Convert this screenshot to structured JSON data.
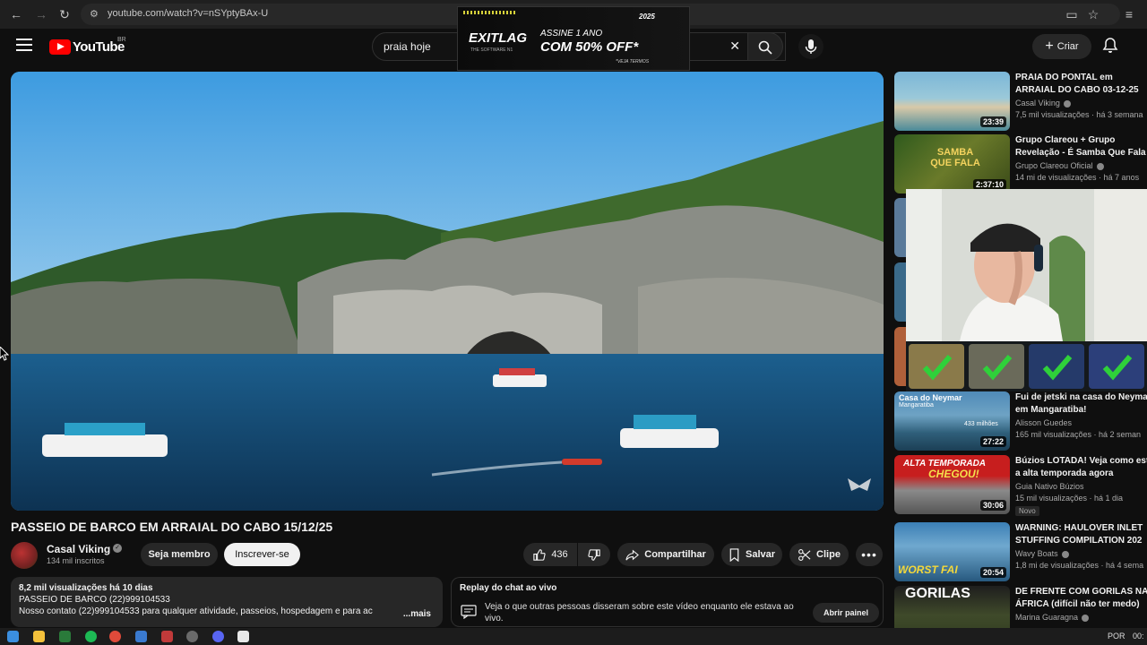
{
  "browser": {
    "url": "youtube.com/watch?v=nSYptyBAx-U"
  },
  "header": {
    "logo_text": "YouTube",
    "country": "BR",
    "search_value": "praia hoje",
    "create_label": "Criar"
  },
  "ad": {
    "brand": "EXITLAG",
    "brand_sub": "THE SOFTWARE N1",
    "line1": "ASSINE 1 ANO",
    "line2": "COM 50% OFF*",
    "terms": "*VEJA TERMOS",
    "badge": "2025"
  },
  "video": {
    "title": "PASSEIO DE BARCO EM ARRAIAL DO CABO 15/12/25",
    "channel": "Casal Viking",
    "subscribers": "134 mil inscritos",
    "member_label": "Seja membro",
    "subscribe_label": "Inscrever-se",
    "likes": "436",
    "share_label": "Compartilhar",
    "save_label": "Salvar",
    "clip_label": "Clipe"
  },
  "description": {
    "stats": "8,2 mil visualizações  há 10 dias",
    "line1": "PASSEIO DE BARCO (22)999104533",
    "line2": "Nosso contato (22)999104533 para qualquer atividade, passeios, hospedagem e para ac",
    "more": "...mais"
  },
  "chat_replay": {
    "title": "Replay do chat ao vivo",
    "text": "Veja o que outras pessoas disseram sobre este vídeo enquanto ele estava ao vivo.",
    "button": "Abrir painel"
  },
  "recommendations": [
    {
      "title1": "PRAIA DO PONTAL em",
      "title2": "ARRAIAL DO CABO 03-12-25",
      "channel": "Casal Viking",
      "stats": "7,5 mil visualizações · há 3 semana",
      "duration": "23:39",
      "thumb_text": ""
    },
    {
      "title1": "Grupo Clareou + Grupo",
      "title2": "Revelação - É Samba Que Fala",
      "channel": "Grupo Clareou Oficial",
      "stats": "14 mi de visualizações · há 7 anos",
      "duration": "2:37:10",
      "thumb_text": "SAMBA QUE FALA"
    },
    {
      "title1": "Fui de jetski na casa do Neyma",
      "title2": "em Mangaratiba!",
      "channel": "Alisson Guedes",
      "stats": "165 mil visualizações · há 2 seman",
      "duration": "27:22",
      "thumb_text": "Casa do Neymar",
      "thumb_text2": "Mangaratiba",
      "thumb_text3": "433 milhões"
    },
    {
      "title1": "Búzios LOTADA! Veja como est",
      "title2": "a alta temporada agora",
      "channel": "Guia Nativo Búzios",
      "stats": "15 mil visualizações · há 1 dia",
      "duration": "30:06",
      "badge": "Novo",
      "thumb_text": "ALTA TEMPORADA",
      "thumb_text2": "CHEGOU!"
    },
    {
      "title1": "WARNING: HAULOVER INLET",
      "title2": "STUFFING COMPILATION 202",
      "channel": "Wavy Boats",
      "stats": "1,8 mi de visualizações · há 4 sema",
      "duration": "20:54",
      "thumb_text": "WORST FAI"
    },
    {
      "title1": "DE FRENTE COM GORILAS NA",
      "title2": "ÁFRICA (difícil não ter medo)",
      "channel": "Marina Guaragna",
      "stats": "",
      "duration": "",
      "thumb_text": "GORILAS"
    }
  ],
  "taskbar": {
    "lang": "POR",
    "time": "00:"
  },
  "colors": {
    "bg": "#0f0f0f",
    "surface": "#272727",
    "accent_red": "#ff0000"
  }
}
